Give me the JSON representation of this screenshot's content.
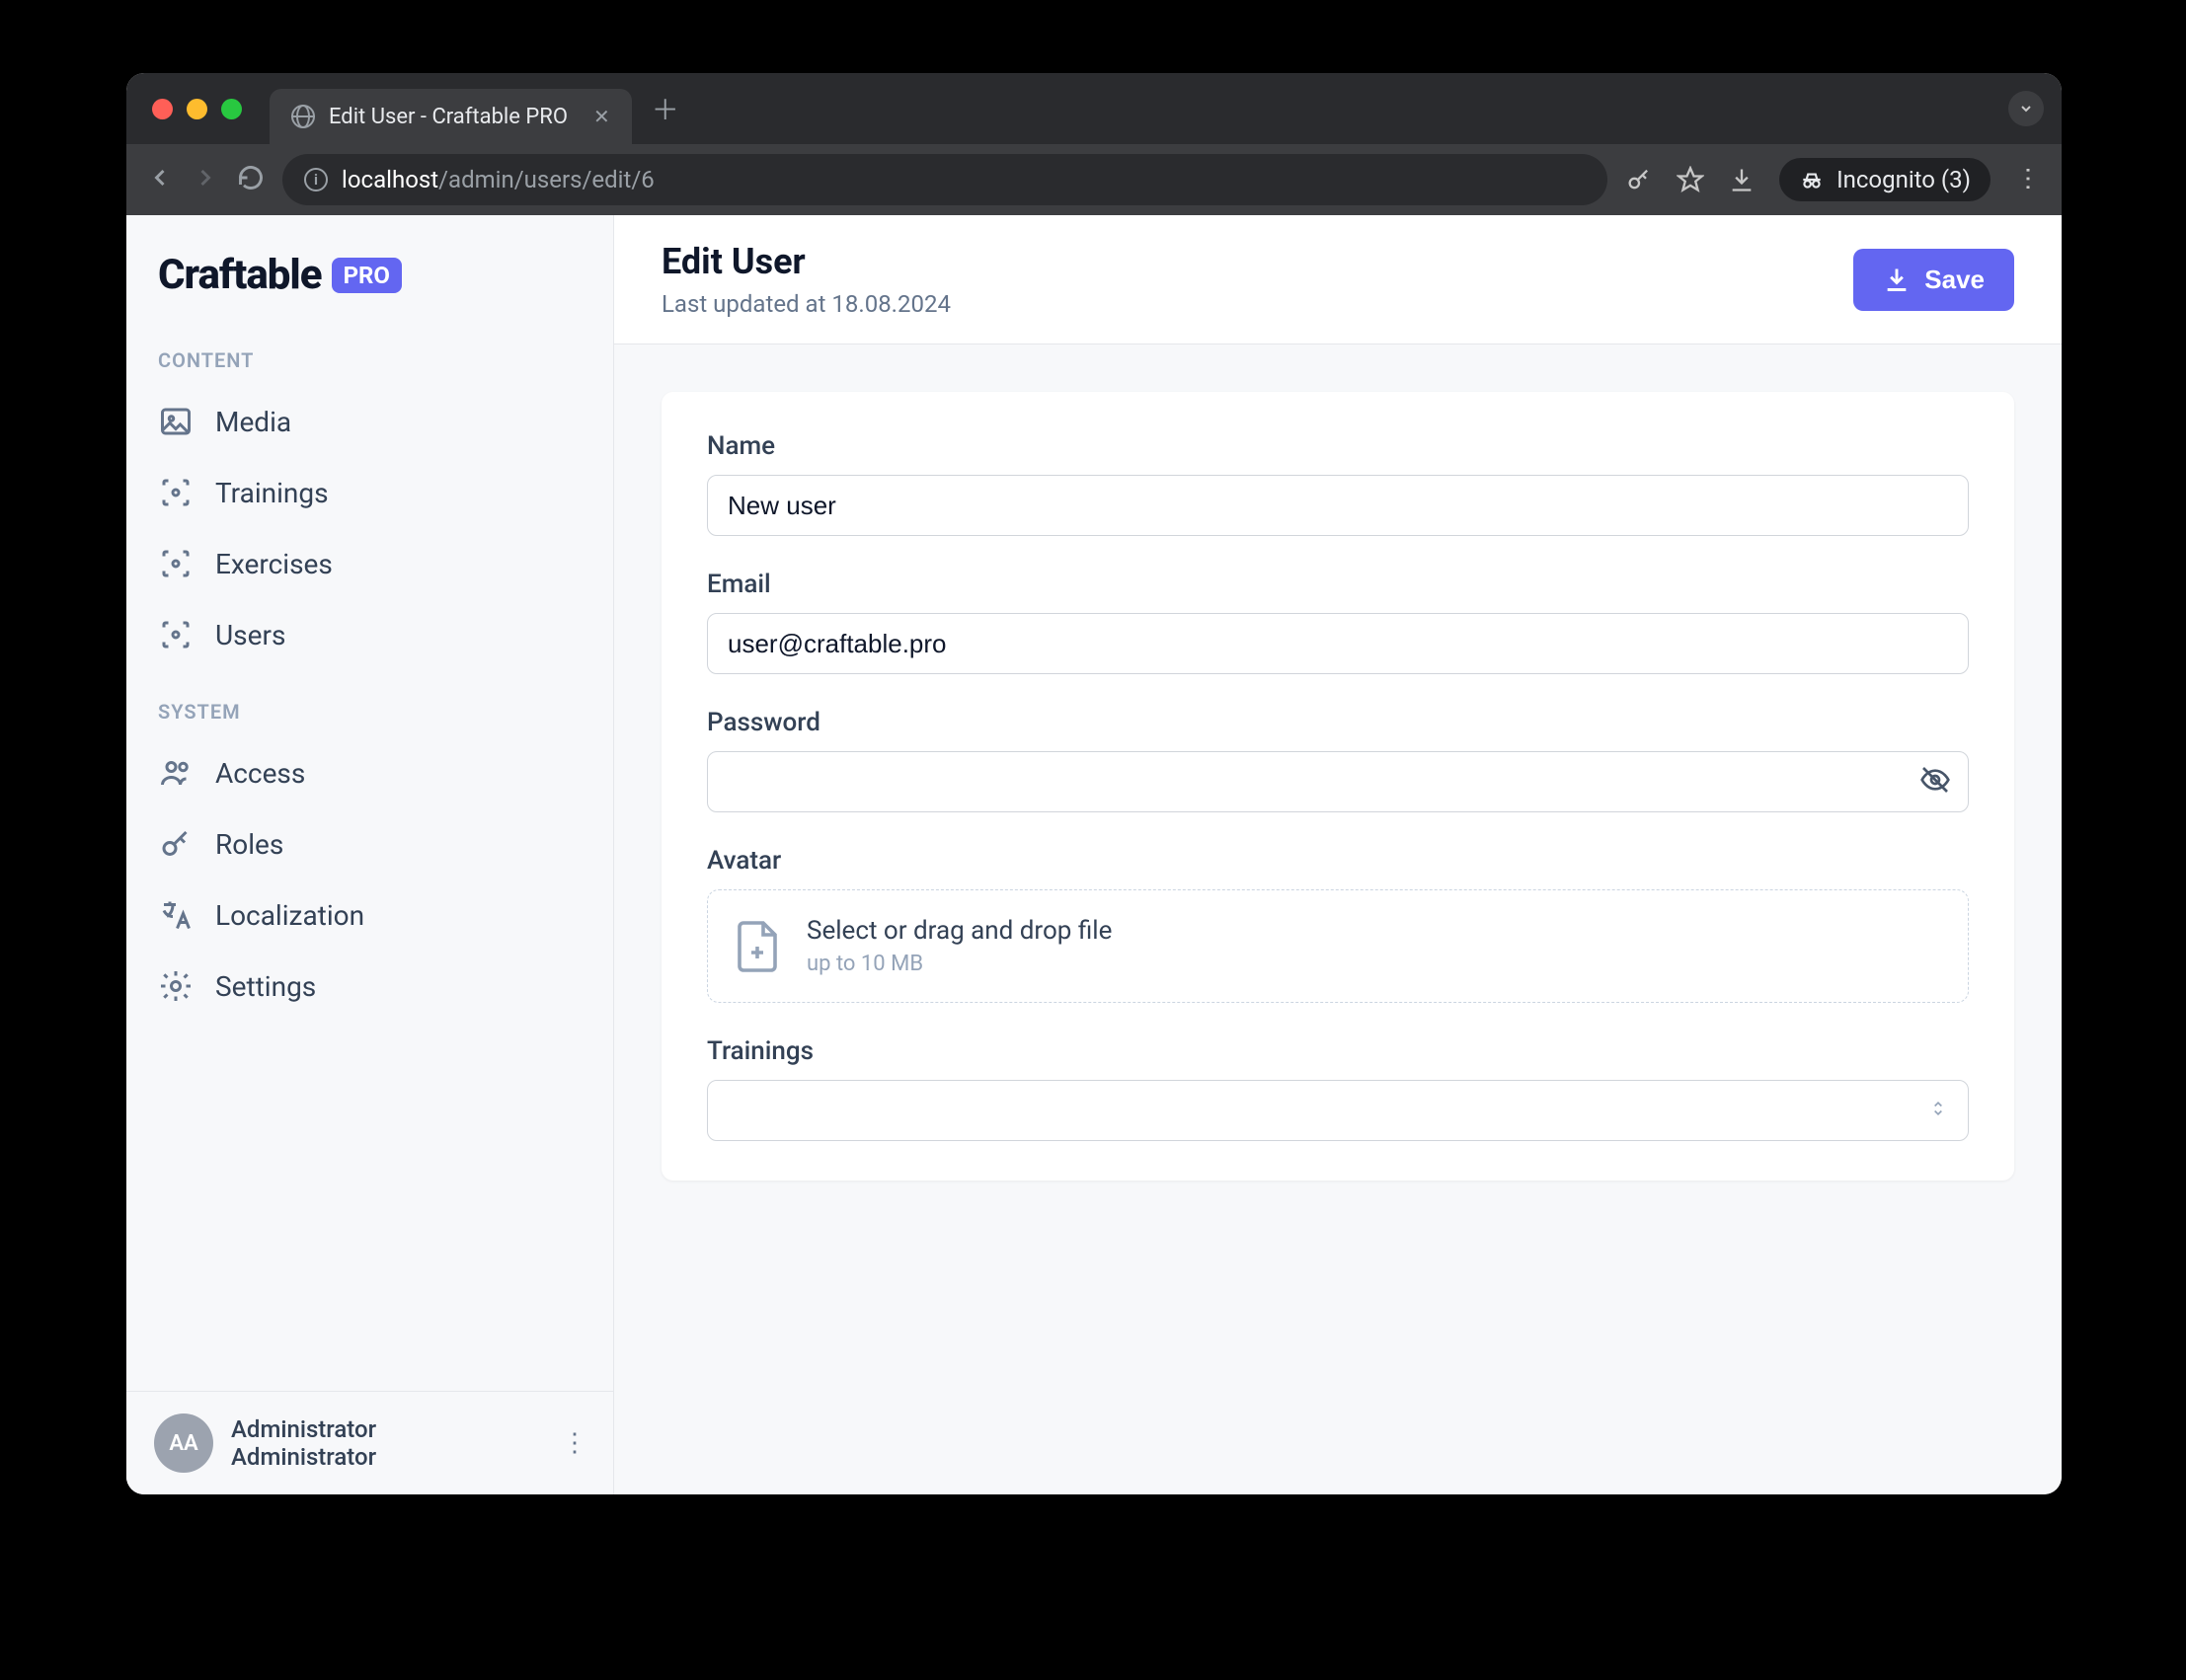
{
  "browser": {
    "tab_title": "Edit User - Craftable PRO",
    "url_host": "localhost",
    "url_path": "/admin/users/edit/6",
    "incognito_label": "Incognito (3)"
  },
  "logo": {
    "text": "Craftable",
    "badge": "PRO"
  },
  "sidebar": {
    "sections": [
      {
        "heading": "CONTENT",
        "items": [
          {
            "label": "Media",
            "icon": "image-icon"
          },
          {
            "label": "Trainings",
            "icon": "scan-icon"
          },
          {
            "label": "Exercises",
            "icon": "scan-icon"
          },
          {
            "label": "Users",
            "icon": "scan-icon"
          }
        ]
      },
      {
        "heading": "SYSTEM",
        "items": [
          {
            "label": "Access",
            "icon": "users-icon"
          },
          {
            "label": "Roles",
            "icon": "key-icon"
          },
          {
            "label": "Localization",
            "icon": "localization-icon"
          },
          {
            "label": "Settings",
            "icon": "gear-icon"
          }
        ]
      }
    ],
    "footer": {
      "avatar_initials": "AA",
      "name1": "Administrator",
      "name2": "Administrator"
    }
  },
  "header": {
    "title": "Edit User",
    "subtitle": "Last updated at 18.08.2024",
    "save_label": "Save"
  },
  "form": {
    "name": {
      "label": "Name",
      "value": "New user"
    },
    "email": {
      "label": "Email",
      "value": "user@craftable.pro"
    },
    "password": {
      "label": "Password",
      "value": ""
    },
    "avatar": {
      "label": "Avatar",
      "drop_text": "Select or drag and drop file",
      "drop_sub": "up to 10 MB"
    },
    "trainings": {
      "label": "Trainings",
      "value": ""
    }
  }
}
